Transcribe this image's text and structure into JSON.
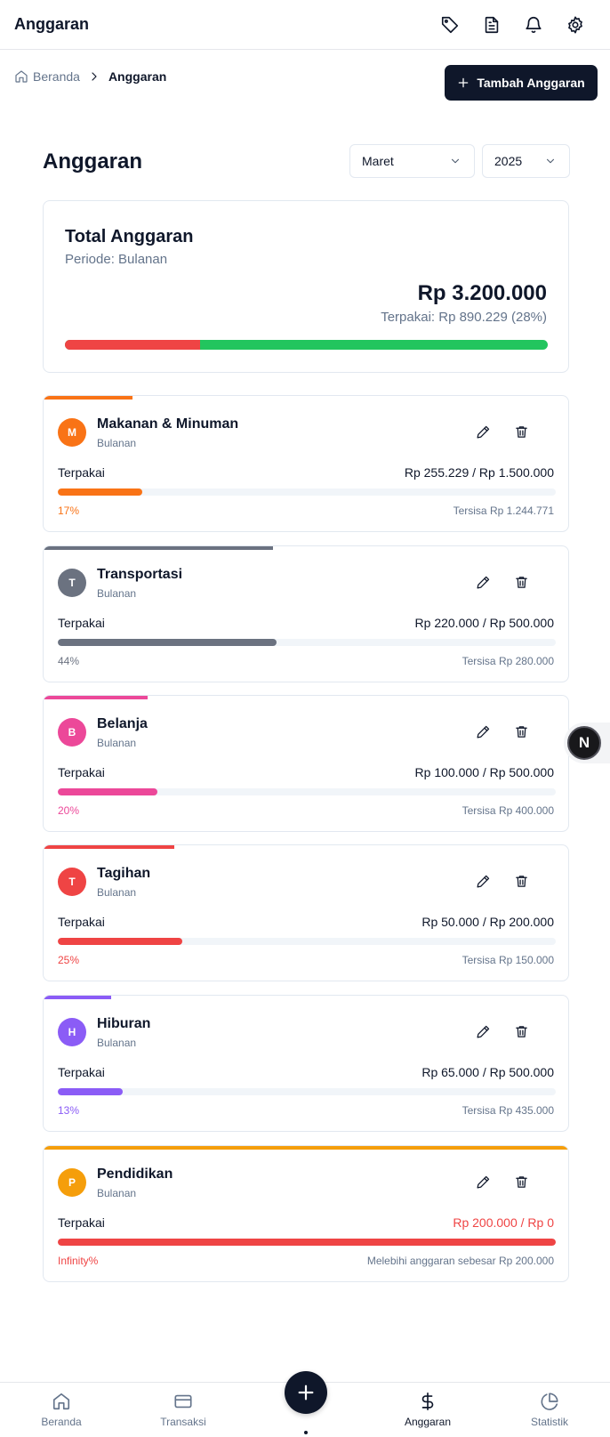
{
  "header": {
    "title": "Anggaran",
    "icons": [
      "tag-icon",
      "file-text-icon",
      "bell-icon",
      "settings-icon"
    ]
  },
  "breadcrumb": {
    "home": "Beranda",
    "current": "Anggaran"
  },
  "add_button_label": "Tambah Anggaran",
  "page_title": "Anggaran",
  "filters": {
    "month": "Maret",
    "year": "2025"
  },
  "summary": {
    "title": "Total Anggaran",
    "period": "Periode: Bulanan",
    "amount": "Rp 3.200.000",
    "used_text": "Terpakai: Rp 890.229 (28%)",
    "used_fraction": 0.28,
    "used_color": "#ef4444",
    "remaining_color": "#22c55e"
  },
  "budgets": [
    {
      "initial": "M",
      "name": "Makanan & Minuman",
      "period": "Bulanan",
      "used_label": "Terpakai",
      "amount": "Rp 255.229 / Rp 1.500.000",
      "percent": "17%",
      "remaining": "Tersisa Rp 1.244.771",
      "fill": 0.17,
      "color": "#f97316",
      "over": false
    },
    {
      "initial": "T",
      "name": "Transportasi",
      "period": "Bulanan",
      "used_label": "Terpakai",
      "amount": "Rp 220.000 / Rp 500.000",
      "percent": "44%",
      "remaining": "Tersisa Rp 280.000",
      "fill": 0.44,
      "color": "#6b7280",
      "over": false
    },
    {
      "initial": "B",
      "name": "Belanja",
      "period": "Bulanan",
      "used_label": "Terpakai",
      "amount": "Rp 100.000 / Rp 500.000",
      "percent": "20%",
      "remaining": "Tersisa Rp 400.000",
      "fill": 0.2,
      "color": "#ec4899",
      "over": false
    },
    {
      "initial": "T",
      "name": "Tagihan",
      "period": "Bulanan",
      "used_label": "Terpakai",
      "amount": "Rp 50.000 / Rp 200.000",
      "percent": "25%",
      "remaining": "Tersisa Rp 150.000",
      "fill": 0.25,
      "color": "#ef4444",
      "over": false
    },
    {
      "initial": "H",
      "name": "Hiburan",
      "period": "Bulanan",
      "used_label": "Terpakai",
      "amount": "Rp 65.000 / Rp 500.000",
      "percent": "13%",
      "remaining": "Tersisa Rp 435.000",
      "fill": 0.13,
      "color": "#8b5cf6",
      "over": false
    },
    {
      "initial": "P",
      "name": "Pendidikan",
      "period": "Bulanan",
      "used_label": "Terpakai",
      "amount": "Rp 200.000 / Rp 0",
      "percent": "Infinity%",
      "remaining": "Melebihi anggaran sebesar Rp 200.000",
      "fill": 1.0,
      "color": "#f59e0b",
      "bar_color": "#ef4444",
      "over": true
    }
  ],
  "dev_badge": "N",
  "bottom_nav": [
    {
      "label": "Beranda",
      "icon": "home-icon",
      "active": false
    },
    {
      "label": "Transaksi",
      "icon": "credit-card-icon",
      "active": false
    },
    {
      "label": "Anggaran",
      "icon": "dollar-icon",
      "active": true
    },
    {
      "label": "Statistik",
      "icon": "pie-chart-icon",
      "active": false
    }
  ],
  "fab_icon": "plus-icon"
}
